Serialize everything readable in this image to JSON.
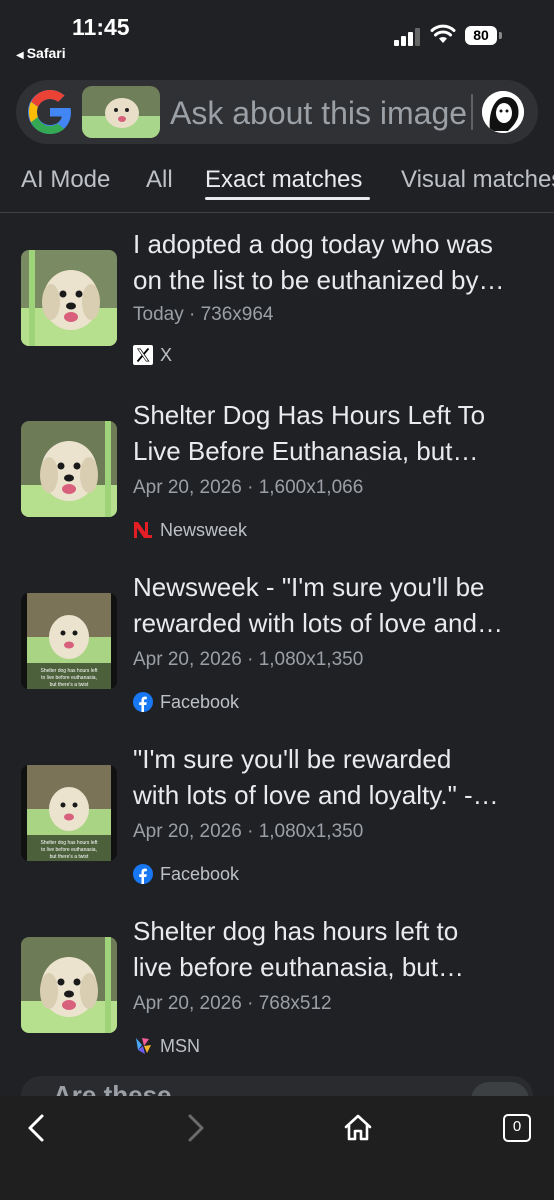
{
  "status": {
    "time": "11:45",
    "back_app": "Safari",
    "battery": "80"
  },
  "search": {
    "logo": "G",
    "placeholder": "Ask about this image"
  },
  "tabs": [
    {
      "label": "AI Mode"
    },
    {
      "label": "All"
    },
    {
      "label": "Exact matches",
      "active": true
    },
    {
      "label": "Visual matches"
    }
  ],
  "results": [
    {
      "title_1": "I adopted a dog today who was",
      "title_2": "on the list to be euthanized by…",
      "meta": "Today · 736x964",
      "source": "X",
      "icon": "x-logo-icon"
    },
    {
      "title_1": "Shelter Dog Has Hours Left To",
      "title_2": "Live Before Euthanasia, but…",
      "meta": "Apr 20, 2026 · 1,600x1,066",
      "source": "Newsweek",
      "icon": "newsweek-logo-icon"
    },
    {
      "title_1": "Newsweek - \"I'm sure you'll be",
      "title_2": "rewarded with lots of love and…",
      "meta": "Apr 20, 2026 · 1,080x1,350",
      "source": "Facebook",
      "icon": "facebook-logo-icon",
      "thumb_caption": "Shelter dog has hours left to live before euthanasia, but there's a twist"
    },
    {
      "title_1": "\"I'm sure you'll be rewarded",
      "title_2": "with lots of love and loyalty.\" -…",
      "meta": "Apr 20, 2026 · 1,080x1,350",
      "source": "Facebook",
      "icon": "facebook-logo-icon",
      "thumb_caption": "Shelter dog has hours left to live before euthanasia, but there's a twist"
    },
    {
      "title_1": "Shelter dog has hours left to",
      "title_2": "live before euthanasia, but…",
      "meta": "Apr 20, 2026 · 768x512",
      "source": "MSN",
      "icon": "msn-logo-icon"
    }
  ],
  "partial_section": {
    "label": "Are these"
  },
  "bottom_nav": {
    "tab_count": "0"
  },
  "colors": {
    "background": "#202124",
    "surface": "#303134",
    "text": "#e8eaed",
    "muted": "#9aa0a6",
    "facebook": "#1877f2",
    "newsweek": "#e31e24"
  }
}
